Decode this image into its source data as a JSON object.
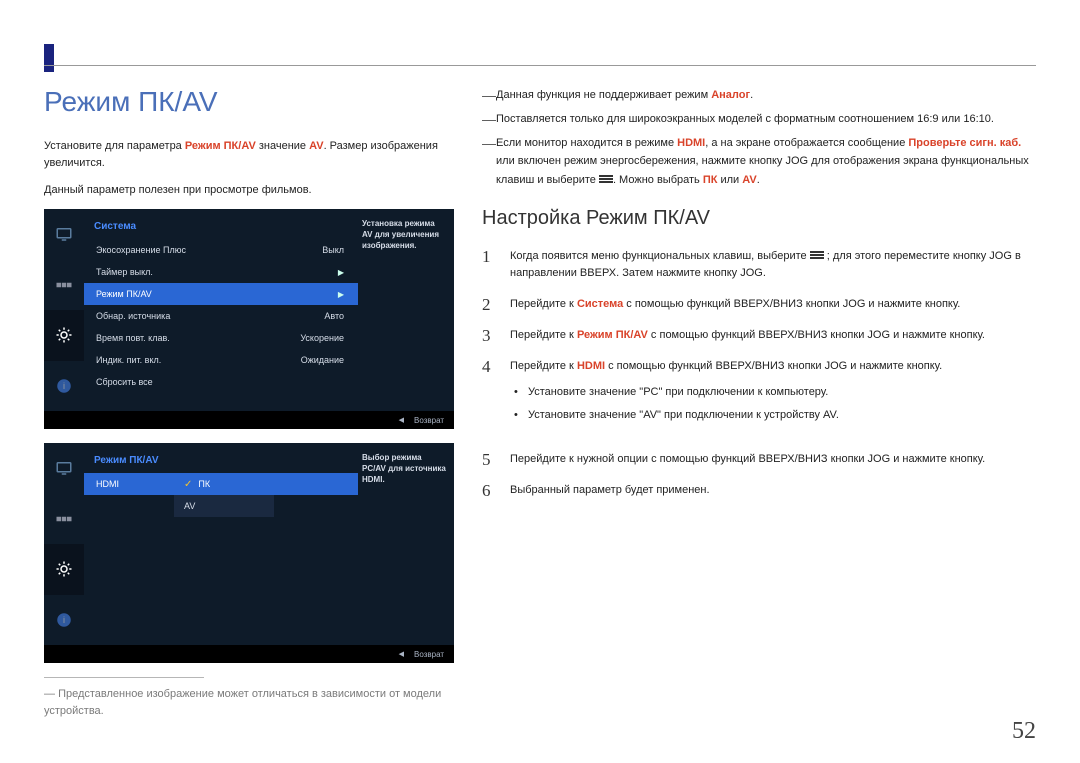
{
  "page_number": "52",
  "left": {
    "heading": "Режим ПК/AV",
    "intro": {
      "t1": "Установите для параметра ",
      "hi1": "Режим ПК/AV",
      "t2": " значение ",
      "hi2": "AV",
      "t3": ". Размер изображения увеличится."
    },
    "intro2": "Данный параметр полезен при просмотре фильмов.",
    "osd1": {
      "title": "Система",
      "desc_title": "Установка режима AV для увеличения изображения.",
      "items": [
        {
          "label": "Экосохранение Плюс",
          "val": "Выкл"
        },
        {
          "label": "Таймер выкл.",
          "val": "",
          "arrow": true
        },
        {
          "label": "Режим ПК/AV",
          "val": "",
          "arrow": true,
          "sel": true
        },
        {
          "label": "Обнар. источника",
          "val": "Авто"
        },
        {
          "label": "Время повт. клав.",
          "val": "Ускорение"
        },
        {
          "label": "Индик. пит. вкл.",
          "val": "Ожидание"
        },
        {
          "label": "Сбросить все",
          "val": ""
        }
      ],
      "foot": "Возврат"
    },
    "osd2": {
      "title": "Режим ПК/AV",
      "desc_title": "Выбор режима PC/AV для источника HDMI.",
      "input": "HDMI",
      "opts": [
        {
          "label": "ПК",
          "sel": true
        },
        {
          "label": "AV"
        }
      ],
      "foot": "Возврат"
    },
    "footnote": "Представленное изображение может отличаться в зависимости от модели устройства."
  },
  "right": {
    "notes": [
      {
        "parts": [
          {
            "t": "Данная функция не поддерживает режим "
          },
          {
            "t": "Аналог",
            "hi": true
          },
          {
            "t": "."
          }
        ]
      },
      {
        "parts": [
          {
            "t": "Поставляется только для широкоэкранных моделей с форматным соотношением 16:9 или 16:10."
          }
        ]
      },
      {
        "parts": [
          {
            "t": "Если монитор находится в режиме "
          },
          {
            "t": "HDMI",
            "hi": true
          },
          {
            "t": ", а на экране отображается сообщение "
          },
          {
            "t": "Проверьте сигн. каб.",
            "hi": true
          },
          {
            "t": " или включен режим энергосбережения, нажмите кнопку JOG для отображения экрана функциональных клавиш и выберите "
          },
          {
            "menu": true
          },
          {
            "t": ". Можно выбрать "
          },
          {
            "t": "ПК",
            "hi": true
          },
          {
            "t": " или "
          },
          {
            "t": "AV",
            "hi": true
          },
          {
            "t": "."
          }
        ]
      }
    ],
    "heading": "Настройка Режим ПК/AV",
    "steps": [
      {
        "parts": [
          {
            "t": "Когда появится меню функциональных клавиш, выберите "
          },
          {
            "menu": true
          },
          {
            "t": " ; для этого переместите кнопку JOG в направлении ВВЕРХ. Затем нажмите кнопку JOG."
          }
        ]
      },
      {
        "parts": [
          {
            "t": "Перейдите к "
          },
          {
            "t": "Система",
            "hi": true
          },
          {
            "t": " с помощью функций ВВЕРХ/ВНИЗ кнопки JOG и нажмите кнопку."
          }
        ]
      },
      {
        "parts": [
          {
            "t": "Перейдите к "
          },
          {
            "t": "Режим ПК/AV",
            "hi": true
          },
          {
            "t": " с помощью функций ВВЕРХ/ВНИЗ кнопки JOG и нажмите кнопку."
          }
        ]
      },
      {
        "parts": [
          {
            "t": "Перейдите к "
          },
          {
            "t": "HDMI",
            "hi": true
          },
          {
            "t": " с помощью функций ВВЕРХ/ВНИЗ кнопки JOG и нажмите кнопку."
          }
        ],
        "bullets": [
          "Установите значение \"PC\" при подключении к компьютеру.",
          "Установите значение \"AV\" при подключении к устройству AV."
        ]
      },
      {
        "parts": [
          {
            "t": "Перейдите к нужной опции с помощью функций ВВЕРХ/ВНИЗ кнопки JOG и нажмите кнопку."
          }
        ]
      },
      {
        "parts": [
          {
            "t": "Выбранный параметр будет применен."
          }
        ]
      }
    ]
  }
}
